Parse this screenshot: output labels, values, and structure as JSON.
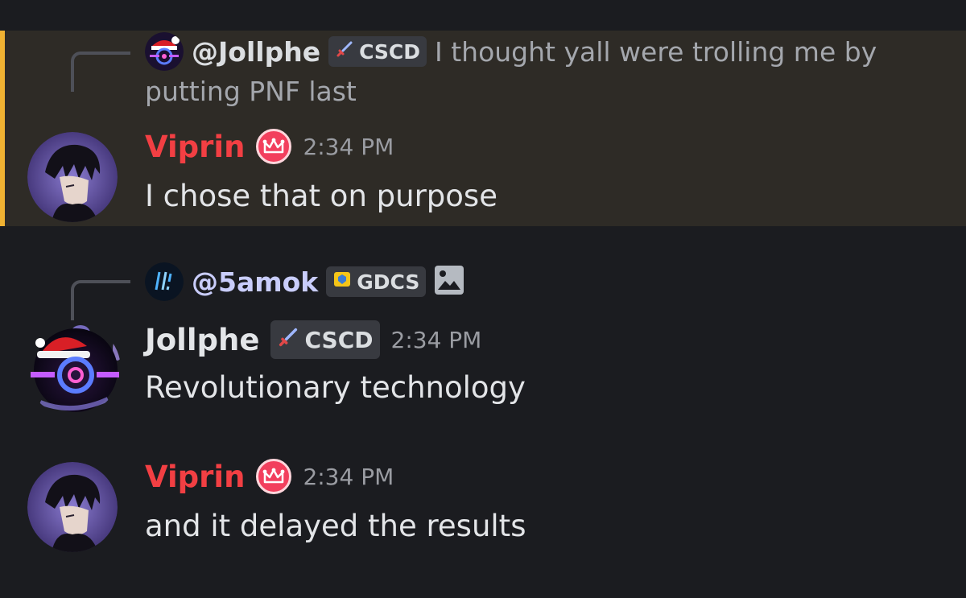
{
  "messages": [
    {
      "reply": {
        "author": "@Jollphe",
        "tag": "CSCD",
        "text": "I thought yall were trolling me by",
        "text_cont": "putting PNF last"
      },
      "author": "Viprin",
      "time": "2:34 PM",
      "content": "I chose that on purpose",
      "highlighted": true
    },
    {
      "reply": {
        "author": "@5amok",
        "tag": "GDCS",
        "attachment_icon": "image-icon"
      },
      "author": "Jollphe",
      "tag": "CSCD",
      "time": "2:34 PM",
      "content": "Revolutionary technology"
    },
    {
      "author": "Viprin",
      "time": "2:34 PM",
      "content": "and it delayed the results"
    }
  ],
  "colors": {
    "background": "#1b1c20",
    "highlight_bg": "#2e2b26",
    "highlight_border": "#f0b232",
    "viprin_name": "#f23f43"
  }
}
